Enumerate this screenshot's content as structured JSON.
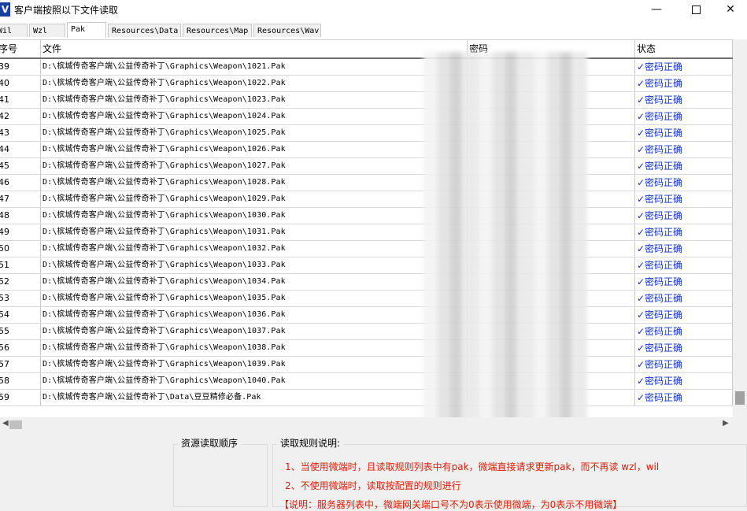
{
  "window": {
    "title": "客户端按照以下文件读取",
    "icon_letter": "V"
  },
  "tabs": [
    {
      "label": "Wil"
    },
    {
      "label": "Wzl"
    },
    {
      "label": "Pak"
    },
    {
      "label": "Resources\\Data"
    },
    {
      "label": "Resources\\Map"
    },
    {
      "label": "Resources\\Wav"
    }
  ],
  "table": {
    "headers": {
      "index": "序号",
      "file": "文件",
      "password": "密码",
      "status": "状态"
    },
    "rows": [
      {
        "index": "39",
        "file": "D:\\槟城传奇客户端\\公益传奇补丁\\Graphics\\Weapon\\1021.Pak",
        "status": "✓密码正确"
      },
      {
        "index": "40",
        "file": "D:\\槟城传奇客户端\\公益传奇补丁\\Graphics\\Weapon\\1022.Pak",
        "status": "✓密码正确"
      },
      {
        "index": "41",
        "file": "D:\\槟城传奇客户端\\公益传奇补丁\\Graphics\\Weapon\\1023.Pak",
        "status": "✓密码正确"
      },
      {
        "index": "42",
        "file": "D:\\槟城传奇客户端\\公益传奇补丁\\Graphics\\Weapon\\1024.Pak",
        "status": "✓密码正确"
      },
      {
        "index": "43",
        "file": "D:\\槟城传奇客户端\\公益传奇补丁\\Graphics\\Weapon\\1025.Pak",
        "status": "✓密码正确"
      },
      {
        "index": "44",
        "file": "D:\\槟城传奇客户端\\公益传奇补丁\\Graphics\\Weapon\\1026.Pak",
        "status": "✓密码正确"
      },
      {
        "index": "45",
        "file": "D:\\槟城传奇客户端\\公益传奇补丁\\Graphics\\Weapon\\1027.Pak",
        "status": "✓密码正确"
      },
      {
        "index": "46",
        "file": "D:\\槟城传奇客户端\\公益传奇补丁\\Graphics\\Weapon\\1028.Pak",
        "status": "✓密码正确"
      },
      {
        "index": "47",
        "file": "D:\\槟城传奇客户端\\公益传奇补丁\\Graphics\\Weapon\\1029.Pak",
        "status": "✓密码正确"
      },
      {
        "index": "48",
        "file": "D:\\槟城传奇客户端\\公益传奇补丁\\Graphics\\Weapon\\1030.Pak",
        "status": "✓密码正确"
      },
      {
        "index": "49",
        "file": "D:\\槟城传奇客户端\\公益传奇补丁\\Graphics\\Weapon\\1031.Pak",
        "status": "✓密码正确"
      },
      {
        "index": "50",
        "file": "D:\\槟城传奇客户端\\公益传奇补丁\\Graphics\\Weapon\\1032.Pak",
        "status": "✓密码正确"
      },
      {
        "index": "51",
        "file": "D:\\槟城传奇客户端\\公益传奇补丁\\Graphics\\Weapon\\1033.Pak",
        "status": "✓密码正确"
      },
      {
        "index": "52",
        "file": "D:\\槟城传奇客户端\\公益传奇补丁\\Graphics\\Weapon\\1034.Pak",
        "status": "✓密码正确"
      },
      {
        "index": "53",
        "file": "D:\\槟城传奇客户端\\公益传奇补丁\\Graphics\\Weapon\\1035.Pak",
        "status": "✓密码正确"
      },
      {
        "index": "54",
        "file": "D:\\槟城传奇客户端\\公益传奇补丁\\Graphics\\Weapon\\1036.Pak",
        "status": "✓密码正确"
      },
      {
        "index": "55",
        "file": "D:\\槟城传奇客户端\\公益传奇补丁\\Graphics\\Weapon\\1037.Pak",
        "status": "✓密码正确"
      },
      {
        "index": "56",
        "file": "D:\\槟城传奇客户端\\公益传奇补丁\\Graphics\\Weapon\\1038.Pak",
        "status": "✓密码正确"
      },
      {
        "index": "57",
        "file": "D:\\槟城传奇客户端\\公益传奇补丁\\Graphics\\Weapon\\1039.Pak",
        "status": "✓密码正确"
      },
      {
        "index": "58",
        "file": "D:\\槟城传奇客户端\\公益传奇补丁\\Graphics\\Weapon\\1040.Pak",
        "status": "✓密码正确"
      },
      {
        "index": "59",
        "file": "D:\\槟城传奇客户端\\公益传奇补丁\\Data\\豆豆精修必备.Pak",
        "status": "✓密码正确"
      }
    ]
  },
  "bottom": {
    "left_group_title": "资源读取顺序",
    "right_group_title": "读取规则说明:",
    "rules": [
      "1、当使用微端时，且读取规则列表中有pak，微端直接请求更新pak，而不再读 wzl，wil",
      "2、不使用微端时，读取按配置的规则进行",
      "【说明：服务器列表中，微端网关端口号不为0表示使用微端，为0表示不用微端】"
    ]
  },
  "colors": {
    "status_text": "#1030d0",
    "rule_text": "#d81e06"
  }
}
